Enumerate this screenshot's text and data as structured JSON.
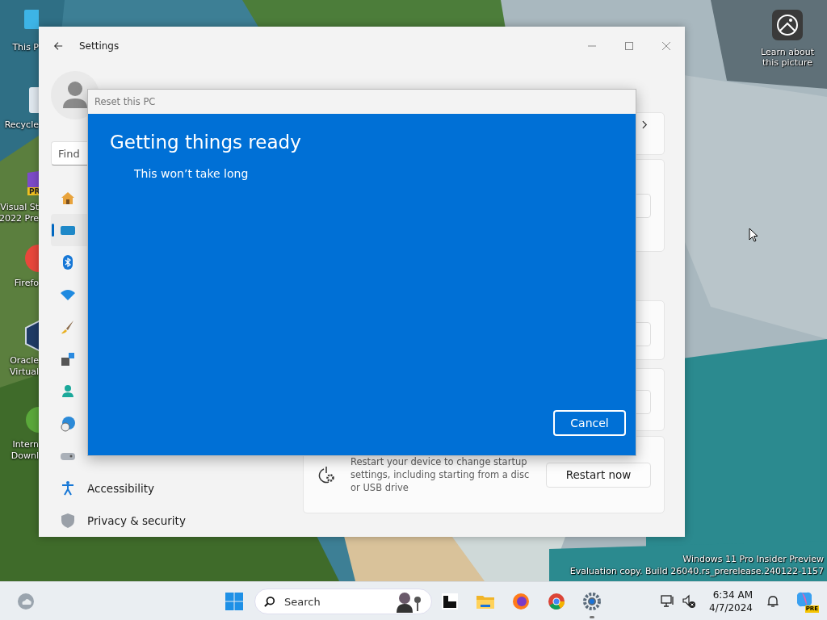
{
  "desktop": {
    "icons": [
      {
        "kind": "pc",
        "lines": [
          "This P"
        ]
      },
      {
        "kind": "recycle",
        "lines": [
          "Recycle"
        ]
      },
      {
        "kind": "studio",
        "lines": [
          "Visual St",
          "2022 Pre"
        ],
        "badge": "PR"
      },
      {
        "kind": "firefox",
        "lines": [
          "Firefo"
        ]
      },
      {
        "kind": "virtualbox",
        "lines": [
          "Oracle",
          "Virtual"
        ]
      },
      {
        "kind": "downloader",
        "lines": [
          "Intern",
          "Downl"
        ]
      }
    ],
    "spotlight": {
      "lines": [
        "Learn about",
        "this picture"
      ]
    },
    "watermark": [
      "Windows 11 Pro Insider Preview",
      "Evaluation copy. Build 26040.rs_prerelease.240122-1157"
    ]
  },
  "settings": {
    "title": "Settings",
    "search": {
      "placeholder": "Find"
    },
    "nav": [
      {
        "kind": "home",
        "selected": false
      },
      {
        "kind": "system",
        "selected": true
      },
      {
        "kind": "bluetooth",
        "selected": false
      },
      {
        "kind": "network",
        "selected": false
      },
      {
        "kind": "personalization",
        "selected": false
      },
      {
        "kind": "apps",
        "selected": false
      },
      {
        "kind": "accounts",
        "selected": false
      },
      {
        "kind": "time",
        "selected": false
      },
      {
        "kind": "gaming",
        "selected": false
      },
      {
        "kind": "accessibility",
        "label": "Accessibility",
        "selected": false
      },
      {
        "kind": "privacy",
        "label": "Privacy & security",
        "selected": false
      }
    ],
    "advanced_startup": {
      "description": "Restart your device to change startup settings, including starting from a disc or USB drive",
      "button": "Restart now"
    }
  },
  "dialog": {
    "title": "Reset this PC",
    "heading": "Getting things ready",
    "subtitle": "This won’t take long",
    "button": "Cancel"
  },
  "taskbar": {
    "search": {
      "placeholder": "Search"
    },
    "apps": [
      {
        "kind": "terminal",
        "selected": false
      },
      {
        "kind": "explorer",
        "selected": false
      },
      {
        "kind": "firefox",
        "selected": false
      },
      {
        "kind": "chrome",
        "selected": false
      },
      {
        "kind": "settings",
        "selected": true
      }
    ],
    "time": "6:34 AM",
    "date": "4/7/2024",
    "copilot_badge": "PRE"
  }
}
